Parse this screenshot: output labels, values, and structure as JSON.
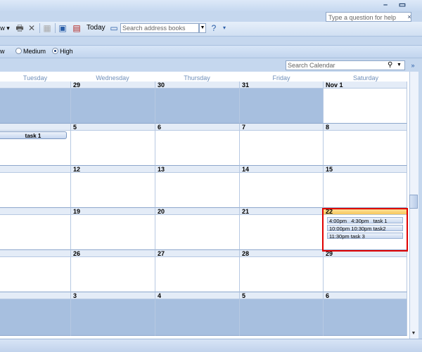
{
  "window": {
    "minimize_icon": "minimize-icon",
    "maximize_icon": "maximize-icon",
    "help_placeholder": "Type a question for help",
    "help_close": "×"
  },
  "toolbar": {
    "partial_label": "w",
    "today_label": "Today",
    "search_placeholder": "Search address books"
  },
  "detail": {
    "partial_label": "w",
    "medium_label": "Medium",
    "high_label": "High",
    "selected": "High"
  },
  "calendar": {
    "search_placeholder": "Search Calendar",
    "days": [
      "Tuesday",
      "Wednesday",
      "Thursday",
      "Friday",
      "Saturday"
    ],
    "weeks": [
      [
        "",
        "29",
        "30",
        "31",
        "Nov 1"
      ],
      [
        "",
        "5",
        "6",
        "7",
        "8"
      ],
      [
        "",
        "12",
        "13",
        "14",
        "15"
      ],
      [
        "",
        "19",
        "20",
        "21",
        "22"
      ],
      [
        "",
        "26",
        "27",
        "28",
        "29"
      ],
      [
        "",
        "3",
        "4",
        "5",
        "6"
      ]
    ],
    "multi_day_event": "task 1",
    "selected_day_events": [
      {
        "start": "4:00pm",
        "end": "4:30pm",
        "title": "task 1"
      },
      {
        "start": "10:00pm",
        "end": "10:30pm",
        "title": "task2"
      },
      {
        "start": "11:30pm",
        "end": "",
        "title": "task 3"
      }
    ]
  },
  "colors": {
    "accent": "#1f4f9c",
    "selection": "#e00000",
    "out_of_month": "#a7bfdf"
  }
}
